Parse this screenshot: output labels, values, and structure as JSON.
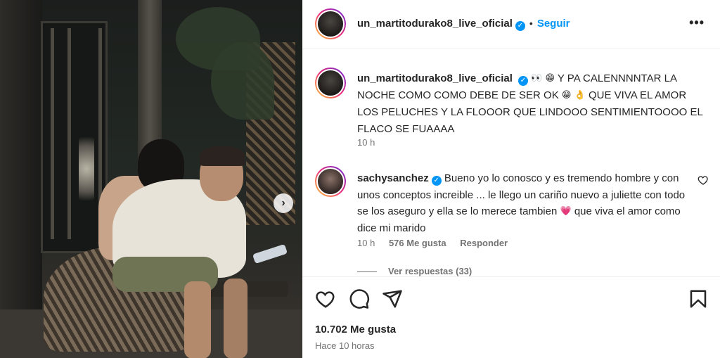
{
  "post": {
    "username": "un_martitodurako8_live_oficial",
    "follow_label": "Seguir",
    "separator": "•",
    "more_label": "•••",
    "caption_text": "Y PA CALENNNNTAR LA NOCHE COMO COMO DEBE DE SER OK",
    "caption_text_2": "QUE VIVA EL AMOR LOS PELUCHES Y LA FLOOOR QUE LINDOOO SENTIMIENTOOOO EL FLACO SE FUAAAA",
    "caption_emojis": [
      "👀",
      "😁"
    ],
    "caption_emojis_2": [
      "😁",
      "👌"
    ],
    "caption_time": "10 h",
    "likes": "10.702 Me gusta",
    "posted_ago": "Hace 10 horas"
  },
  "comment": {
    "username": "sachysanchez",
    "text": "Bueno yo lo conosco y es tremendo hombre y con unos conceptos increible ... le llego un cariño nuevo a juliette con todo se los aseguro y ella se lo merece tambien",
    "text_end": "que viva el amor como dice mi marido",
    "emoji": "💗",
    "time": "10 h",
    "likes": "576 Me gusta",
    "reply_label": "Responder",
    "view_replies": "Ver respuestas (33)"
  },
  "photo": {
    "next_label": "›"
  },
  "icons": {
    "verified": "verified-badge-icon",
    "like": "heart-icon",
    "comment": "comment-bubble-icon",
    "share": "paper-plane-icon",
    "save": "bookmark-icon",
    "more": "more-options-icon"
  },
  "colors": {
    "accent": "#0095f6",
    "text": "#262626",
    "muted": "#737373",
    "divider": "#efefef"
  }
}
